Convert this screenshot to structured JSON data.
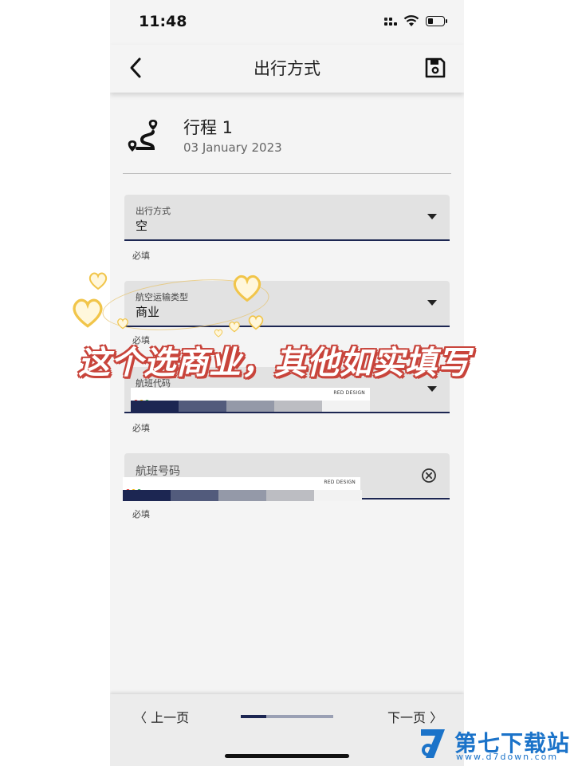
{
  "status_bar": {
    "time": "11:48"
  },
  "header": {
    "title": "出行方式"
  },
  "trip": {
    "name": "行程 1",
    "date": "03 January 2023"
  },
  "form": {
    "fields": [
      {
        "label": "出行方式",
        "value": "空",
        "helper": "必填"
      },
      {
        "label": "航空运输类型",
        "value": "商业",
        "helper": "必填"
      },
      {
        "label": "航班代码",
        "value": "",
        "helper": "必填"
      },
      {
        "label": "航班号码",
        "value": "",
        "helper": "必填"
      }
    ]
  },
  "swatch_strip": {
    "brand": "RED DESIGN",
    "dot_colors": [
      "#e53935",
      "#f4b400",
      "#34a853"
    ],
    "colors": [
      "#1c2652",
      "#525b7c",
      "#9499a8",
      "#bcbdc2",
      "#f2f2f2"
    ]
  },
  "footer": {
    "prev_label": "〈 上一页",
    "next_label": "下一页 〉",
    "progress": 0.28
  },
  "overlay": {
    "caption": "这个选商业，其他如实填写"
  },
  "watermark": {
    "brand": "第七下载站",
    "url": "www.d7down.com"
  },
  "colors": {
    "accent": "#1c2652",
    "field_bg": "#e2e2e2",
    "background": "#f4f4f4",
    "caption_outline": "#c8443b",
    "watermark": "#1b73c9"
  }
}
